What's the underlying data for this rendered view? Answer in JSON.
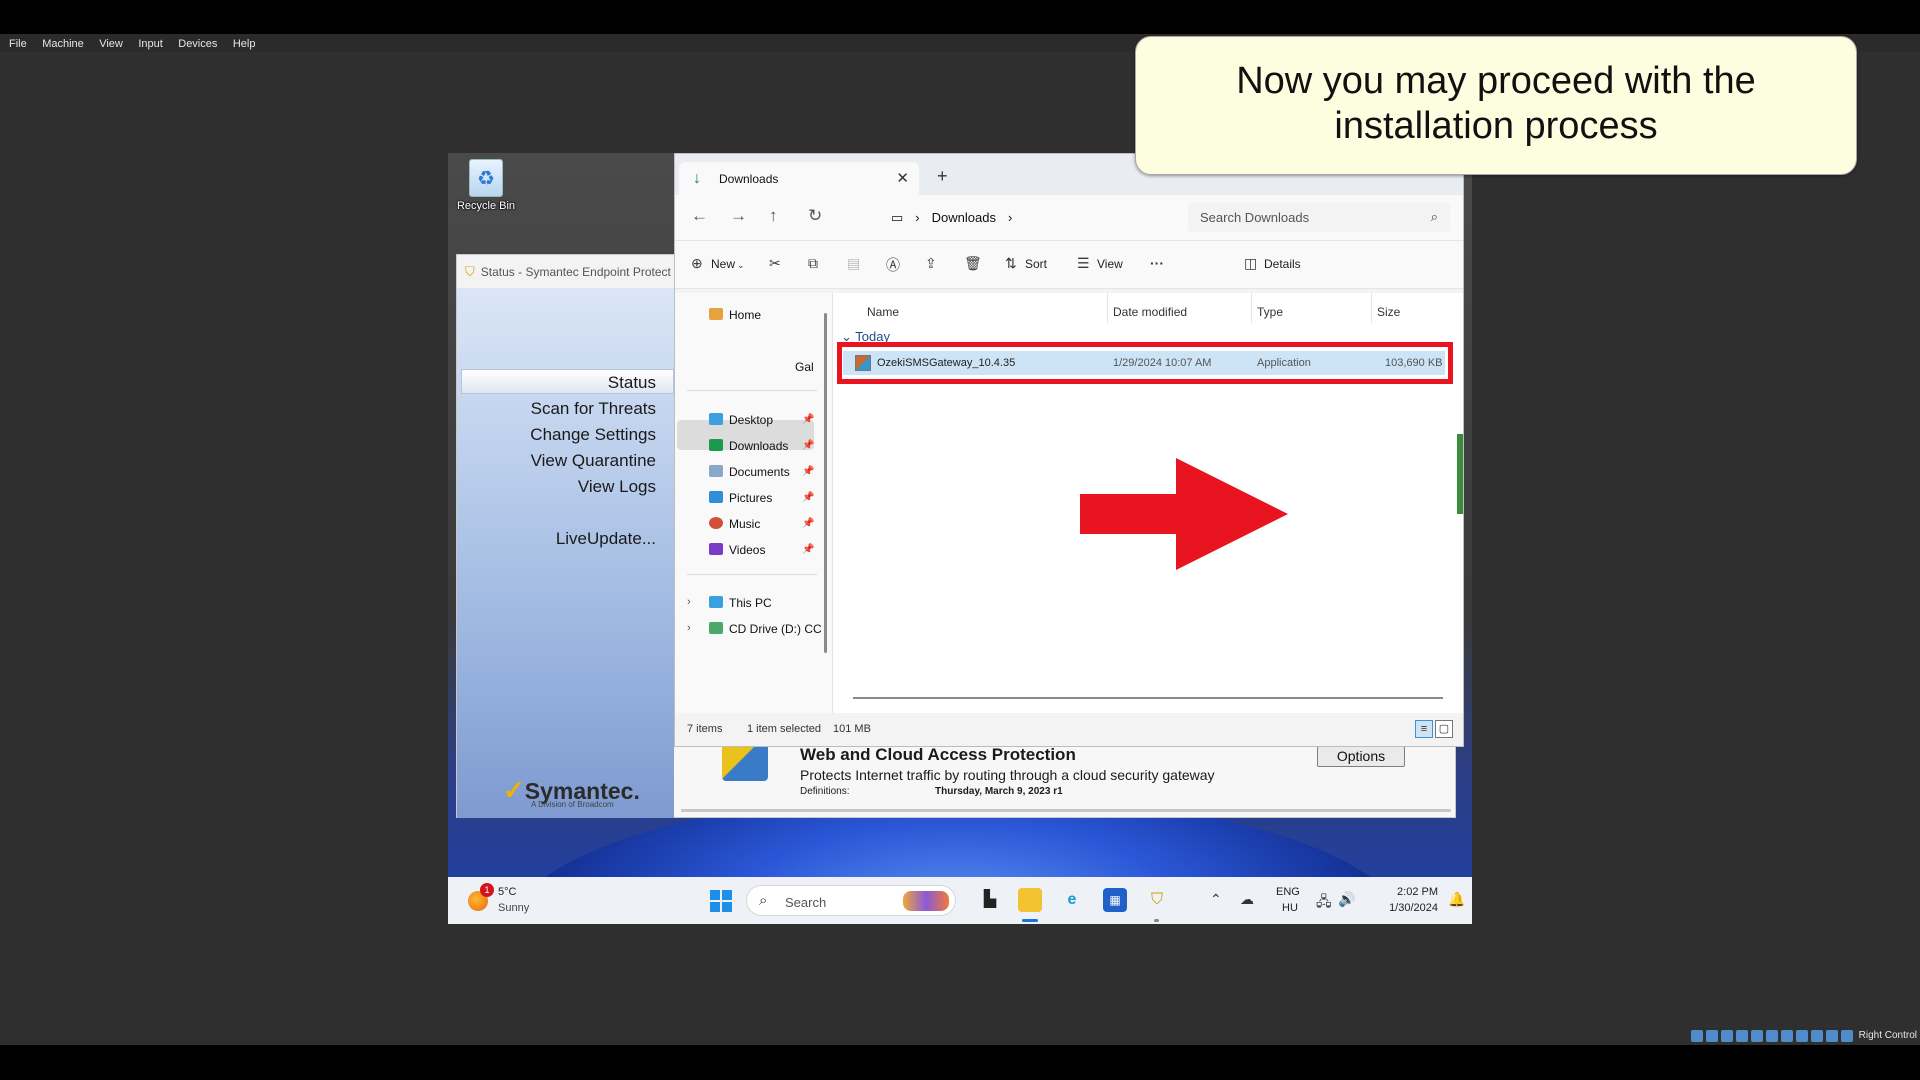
{
  "host": {
    "menu": [
      "File",
      "Machine",
      "View",
      "Input",
      "Devices",
      "Help"
    ],
    "hostkey_label": "Right Control"
  },
  "callout": {
    "text": "Now you may proceed with the installation process"
  },
  "desktop": {
    "recycle_bin_label": "Recycle Bin"
  },
  "symantec": {
    "title": "Status - Symantec Endpoint Protect",
    "nav": [
      "Status",
      "Scan for Threats",
      "Change Settings",
      "View Quarantine",
      "View Logs",
      "LiveUpdate..."
    ],
    "logo_text": "Symantec.",
    "logo_sub": "A Division of Broadcom",
    "wca_title": "Web and Cloud Access Protection",
    "wca_desc": "Protects Internet traffic by routing through a cloud security gateway",
    "definitions_label": "Definitions:",
    "definitions_value": "Thursday, March 9, 2023 r1",
    "options_label": "Options"
  },
  "explorer": {
    "tab_title": "Downloads",
    "breadcrumb": "Downloads",
    "search_placeholder": "Search Downloads",
    "commands": {
      "new": "New",
      "sort": "Sort",
      "view": "View",
      "details": "Details"
    },
    "nav": {
      "home": "Home",
      "gallery": "Gal",
      "quick": [
        "Desktop",
        "Downloads",
        "Documents",
        "Pictures",
        "Music",
        "Videos"
      ],
      "this_pc": "This PC",
      "cd_drive": "CD Drive (D:) CC"
    },
    "columns": [
      "Name",
      "Date modified",
      "Type",
      "Size"
    ],
    "group_label": "Today",
    "files": [
      {
        "name": "OzekiSMSGateway_10.4.35",
        "date": "1/29/2024 10:07 AM",
        "type": "Application",
        "size": "103,690 KB"
      }
    ],
    "status": {
      "items": "7 items",
      "selected": "1 item selected",
      "size": "101 MB"
    }
  },
  "taskbar": {
    "weather_badge": "1",
    "temperature": "5°C",
    "condition": "Sunny",
    "search_label": "Search",
    "lang_primary": "ENG",
    "lang_secondary": "HU",
    "time": "2:02 PM",
    "date": "1/30/2024"
  },
  "colors": {
    "highlight_red": "#e8141f",
    "callout_bg": "#fdfde0",
    "selection_blue": "#cde3f6"
  }
}
